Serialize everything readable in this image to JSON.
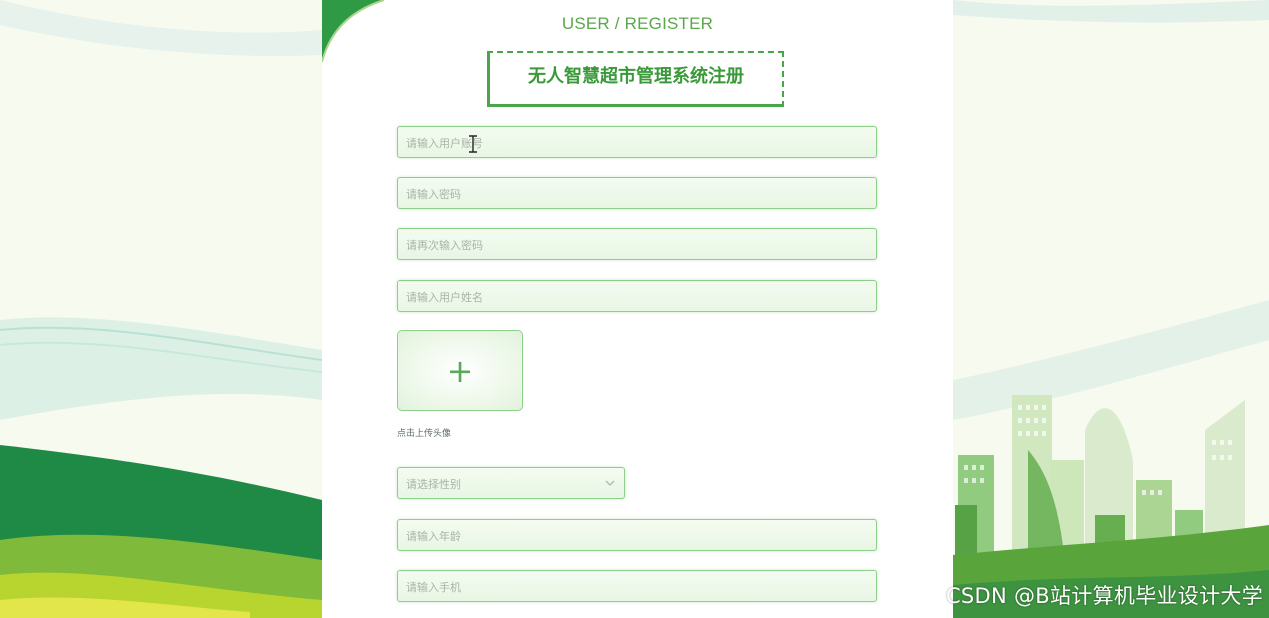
{
  "header": {
    "eyebrow": "USER / REGISTER",
    "title": "无人智慧超市管理系统注册"
  },
  "form": {
    "username_placeholder": "请输入用户账号",
    "password_placeholder": "请输入密码",
    "confirm_password_placeholder": "请再次输入密码",
    "name_placeholder": "请输入用户姓名",
    "avatar_upload_symbol": "+",
    "avatar_upload_hint": "点击上传头像",
    "gender_placeholder": "请选择性别",
    "age_placeholder": "请输入年龄",
    "phone_placeholder": "请输入手机"
  },
  "watermark": "CSDN @B站计算机毕业设计大学",
  "colors": {
    "accent": "#4aa54a",
    "field_border": "#8ccf86",
    "placeholder": "#a8b4a6",
    "page_bg": "#f7faf0"
  },
  "icons": [
    "plus-icon",
    "chevron-down-icon",
    "text-cursor-icon"
  ]
}
